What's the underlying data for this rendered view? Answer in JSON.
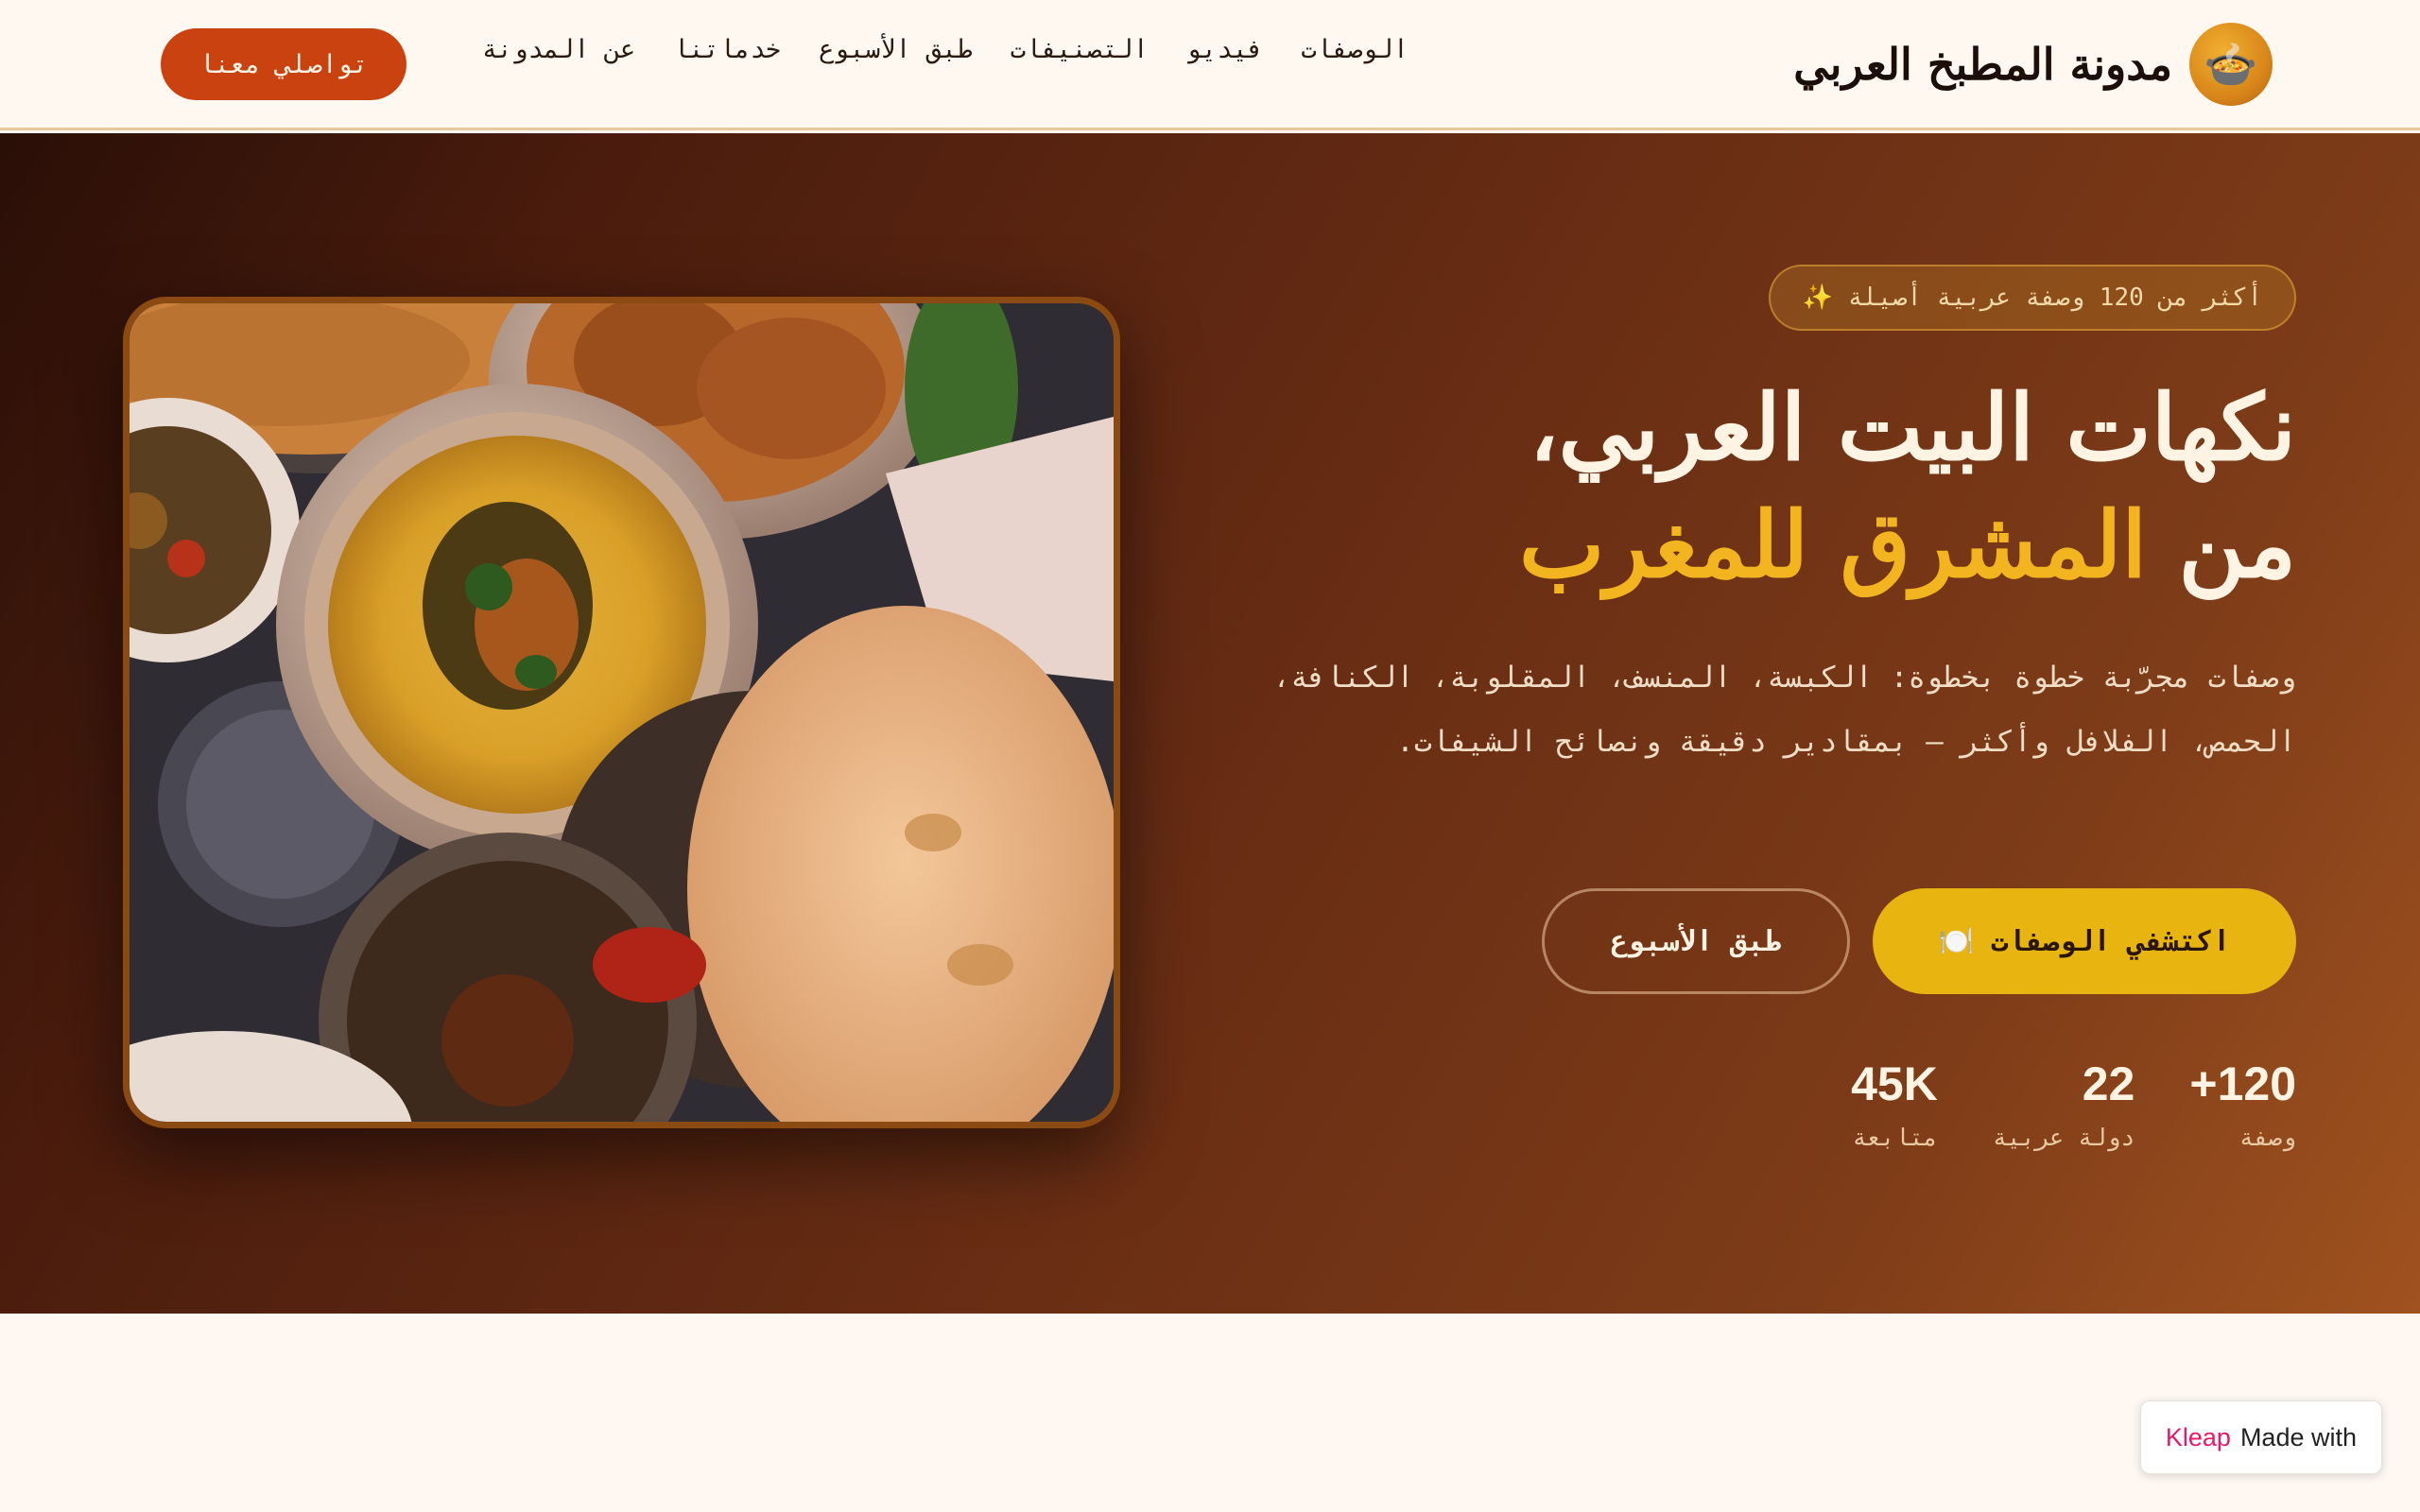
{
  "header": {
    "brand_name": "مدونة المطبخ العربي",
    "brand_icon": "🍲",
    "nav": [
      {
        "label": "الوصفات"
      },
      {
        "label": "فيديو"
      },
      {
        "label": "التصنيفات"
      },
      {
        "label": "طبق الأسبوع"
      },
      {
        "label": "خدماتنا"
      },
      {
        "label": "عن المدونة"
      }
    ],
    "contact_label": "تواصلي معنا"
  },
  "hero": {
    "badge": "✨ أكثر من 120 وصفة عربية أصيلة",
    "title_line1": "نكهات البيت العربي،",
    "title_line2_prefix": "من ",
    "title_line2_accent": "المشرق للمغرب",
    "description": "وصفات مجرّبة خطوة بخطوة: الكبسة، المنسف، المقلوبة، الكنافة، الحمص، الفلافل وأكثر — بمقادير دقيقة ونصائح الشيفات.",
    "primary_button": "🍽️ اكتشفي الوصفات",
    "secondary_button": "طبق الأسبوع",
    "stats": [
      {
        "value": "+120",
        "label": "وصفة"
      },
      {
        "value": "22",
        "label": "دولة عربية"
      },
      {
        "value": "45K",
        "label": "متابعة"
      }
    ]
  },
  "footer_badge": {
    "prefix": "Made with",
    "brand": "Kleap"
  },
  "colors": {
    "accent": "#e8b410",
    "contact": "#c9420f",
    "title_accent": "#f2b41f"
  }
}
